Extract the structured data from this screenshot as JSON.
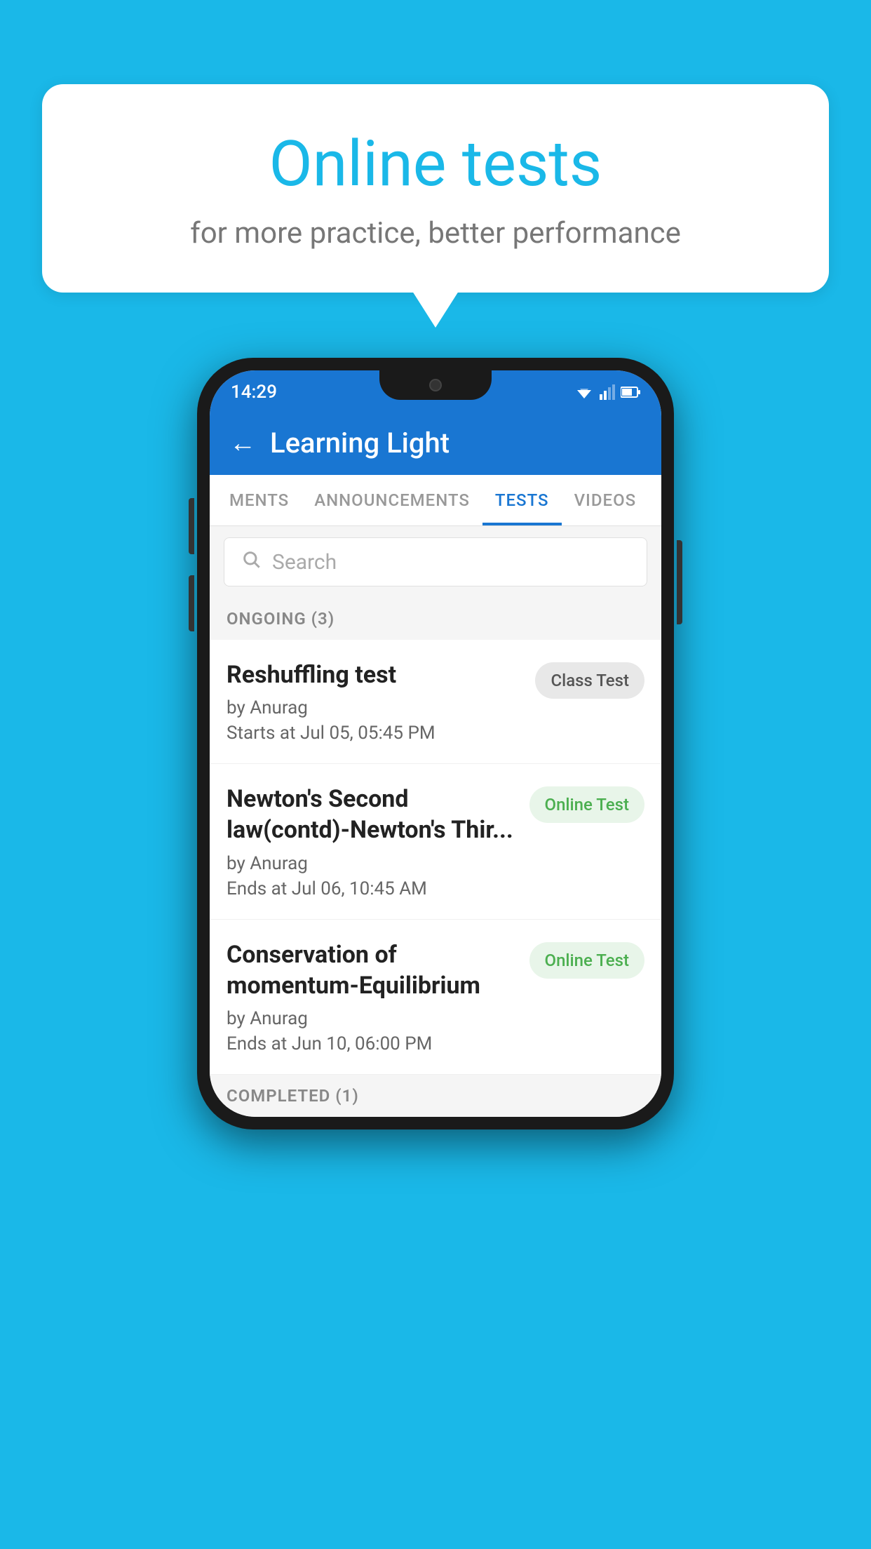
{
  "hero": {
    "title": "Online tests",
    "subtitle": "for more practice, better performance"
  },
  "phone": {
    "status": {
      "time": "14:29"
    },
    "appBar": {
      "title": "Learning Light",
      "backLabel": "←"
    },
    "tabs": [
      {
        "label": "MENTS",
        "active": false
      },
      {
        "label": "ANNOUNCEMENTS",
        "active": false
      },
      {
        "label": "TESTS",
        "active": true
      },
      {
        "label": "VIDEOS",
        "active": false
      }
    ],
    "search": {
      "placeholder": "Search"
    },
    "ongoingSection": {
      "label": "ONGOING (3)"
    },
    "tests": [
      {
        "name": "Reshuffling test",
        "by": "by Anurag",
        "date": "Starts at  Jul 05, 05:45 PM",
        "badge": "Class Test",
        "badgeType": "class"
      },
      {
        "name": "Newton's Second law(contd)-Newton's Thir...",
        "by": "by Anurag",
        "date": "Ends at  Jul 06, 10:45 AM",
        "badge": "Online Test",
        "badgeType": "online"
      },
      {
        "name": "Conservation of momentum-Equilibrium",
        "by": "by Anurag",
        "date": "Ends at  Jun 10, 06:00 PM",
        "badge": "Online Test",
        "badgeType": "online"
      }
    ],
    "completedSection": {
      "label": "COMPLETED (1)"
    }
  }
}
